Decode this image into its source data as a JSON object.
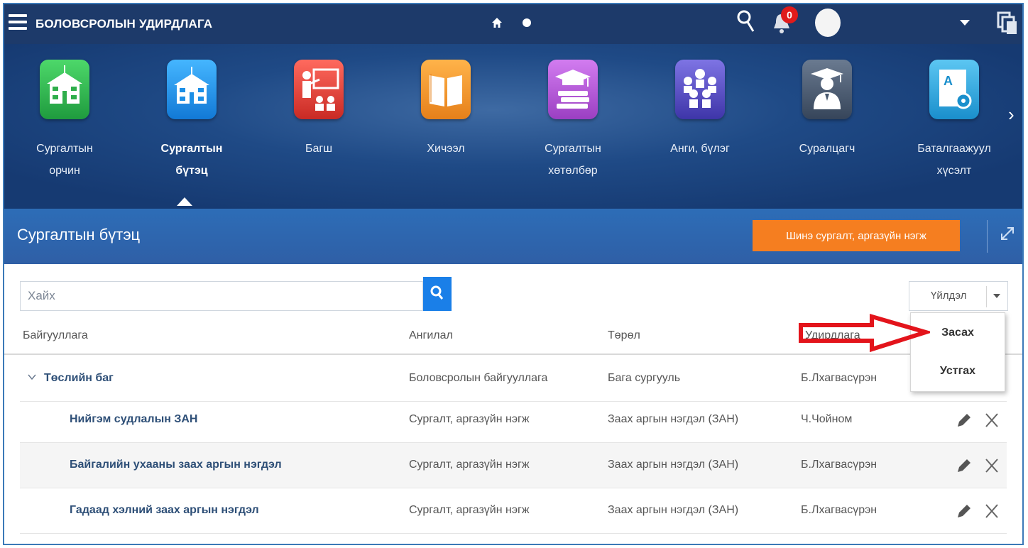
{
  "topbar": {
    "title": "БОЛОВСРОЛЫН УДИРДЛАГА",
    "notification_count": "0"
  },
  "modules": [
    {
      "label_line1": "Сургалтын",
      "label_line2": "орчин",
      "icon": "school-building-icon",
      "color": "#2fae4b"
    },
    {
      "label_line1": "Сургалтын",
      "label_line2": "бүтэц",
      "icon": "school-structure-icon",
      "color": "#1c8fe6",
      "active": true
    },
    {
      "label_line1": "Багш",
      "label_line2": "",
      "icon": "teacher-icon",
      "color": "#e5403a"
    },
    {
      "label_line1": "Хичээл",
      "label_line2": "",
      "icon": "book-icon",
      "color": "#f39a1e"
    },
    {
      "label_line1": "Сургалтын",
      "label_line2": "хөтөлбөр",
      "icon": "curriculum-icon",
      "color": "#b44fd0"
    },
    {
      "label_line1": "Анги, бүлэг",
      "label_line2": "",
      "icon": "group-icon",
      "color": "#5a4fc8"
    },
    {
      "label_line1": "Суралцагч",
      "label_line2": "",
      "icon": "student-icon",
      "color": "#4a5a70"
    },
    {
      "label_line1": "Баталгаажуул",
      "label_line2": "хүсэлт",
      "icon": "certificate-request-icon",
      "color": "#29a6df"
    }
  ],
  "section": {
    "title": "Сургалтын бүтэц",
    "new_button_label": "Шинэ сургалт, аргазүйн нэгж"
  },
  "search": {
    "placeholder": "Хайх"
  },
  "action_dropdown": {
    "label": "Үйлдэл",
    "options": [
      "Засах",
      "Устгах"
    ]
  },
  "table": {
    "columns": [
      "Байгууллага",
      "Ангилал",
      "Төрөл",
      "Удирдлага"
    ],
    "rows": [
      {
        "name": "Төслийн баг",
        "category": "Боловсролын байгууллага",
        "type": "Бага сургууль",
        "manager": "Б.Лхагвасүрэн",
        "group": true
      },
      {
        "name": "Нийгэм судлалын ЗАН",
        "category": "Сургалт, аргазүйн нэгж",
        "type": "Заах аргын нэгдэл (ЗАН)",
        "manager": "Ч.Чойном"
      },
      {
        "name": "Байгалийн ухааны заах аргын нэгдэл",
        "category": "Сургалт, аргазүйн нэгж",
        "type": "Заах аргын нэгдэл (ЗАН)",
        "manager": "Б.Лхагвасүрэн"
      },
      {
        "name": "Гадаад хэлний заах аргын нэгдэл",
        "category": "Сургалт, аргазүйн нэгж",
        "type": "Заах аргын нэгдэл (ЗАН)",
        "manager": "Б.Лхагвасүрэн"
      }
    ]
  },
  "colors": {
    "topbar": "#1d3a6a",
    "accent_orange": "#f57e20",
    "search_blue": "#1a7fe8",
    "annotation_red": "#e3141b"
  }
}
